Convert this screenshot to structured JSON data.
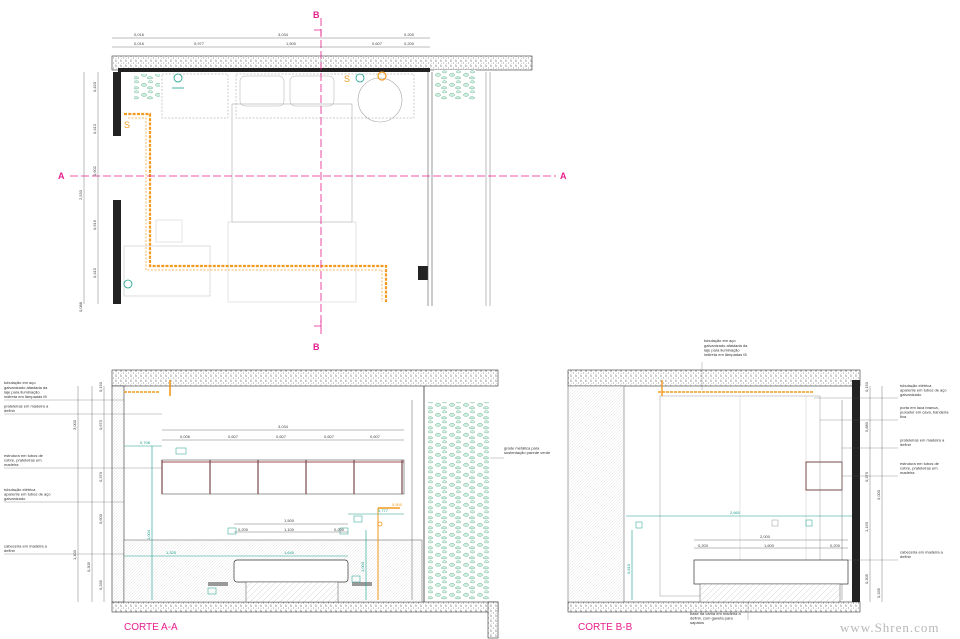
{
  "plan": {
    "section_a": "A",
    "section_b": "B",
    "socket_symbol": "S",
    "top_dims_row1": [
      "0,016",
      "3,034",
      "0,200"
    ],
    "top_dims_row2": [
      "0,016",
      "0,977",
      "1,500",
      "0,607",
      "0,200"
    ],
    "left_dims_outer": [
      "2,533",
      "0,088"
    ],
    "left_dims_inner": [
      "0,420",
      "0,413",
      "0,602",
      "0,616",
      "0,415"
    ]
  },
  "section_aa": {
    "title": "CORTE A-A",
    "left_notes": [
      "tubulação em aço galvanizado afastada da laje para iluminação indireta em lâmpadas t5",
      "prateleiras em madeira a definir",
      "estrutura em tubos de cobre, prateleiras em madeira",
      "tubulação elétrica aparente em tubos de aço galvanizado",
      "cabeceira em madeira a definir"
    ],
    "right_note": "grade metálica para sustentação parede verde",
    "shelf_dims_total": "3,034",
    "shelf_dims": [
      "0,006",
      "0,607",
      "0,607",
      "0,607",
      "0,607"
    ],
    "bed_dims_total": "1,500",
    "bed_dims": [
      "0,200",
      "1,100",
      "0,200"
    ],
    "green_dims": [
      "0,708",
      "1,325",
      "1,640",
      "0,777",
      "0,500",
      "1,004",
      "1,000"
    ],
    "vertical_dims": [
      "0,150",
      "0,670",
      "0,370",
      "0,600",
      "1,400",
      "0,305",
      "0,335",
      "3,000"
    ]
  },
  "section_bb": {
    "title": "CORTE B-B",
    "top_note": "tubulação em aço galvanizado afastada da laje para iluminação indireta em lâmpadas t5",
    "right_notes": [
      "tubulação elétrica aparente em tubos de aço galvanizado",
      "porta em laca branca, puxador em cava, bandeira fixa",
      "prateleiras em madeira a definir",
      "estrutura em tubos de cobre, prateleiras em madeira",
      "cabeceira em madeira a definir"
    ],
    "bottom_note": "base da cama em madeira a definir, com gaveta para sapatos",
    "bed_dims_total": "2,000",
    "bed_dims": [
      "0,200",
      "1,600",
      "0,200"
    ],
    "green_dims": [
      "2,660",
      "0,810"
    ],
    "vertical_dims": [
      "0,150",
      "0,880",
      "0,370",
      "1,150",
      "0,305",
      "0,335",
      "3,000"
    ]
  },
  "watermark": "www.Shren.com",
  "colors": {
    "section_line": "#e61e8c",
    "conduit": "#f39a1e",
    "dimension_green": "#1a9e8c",
    "wall": "#222222",
    "plant": "#7fc4a8"
  }
}
